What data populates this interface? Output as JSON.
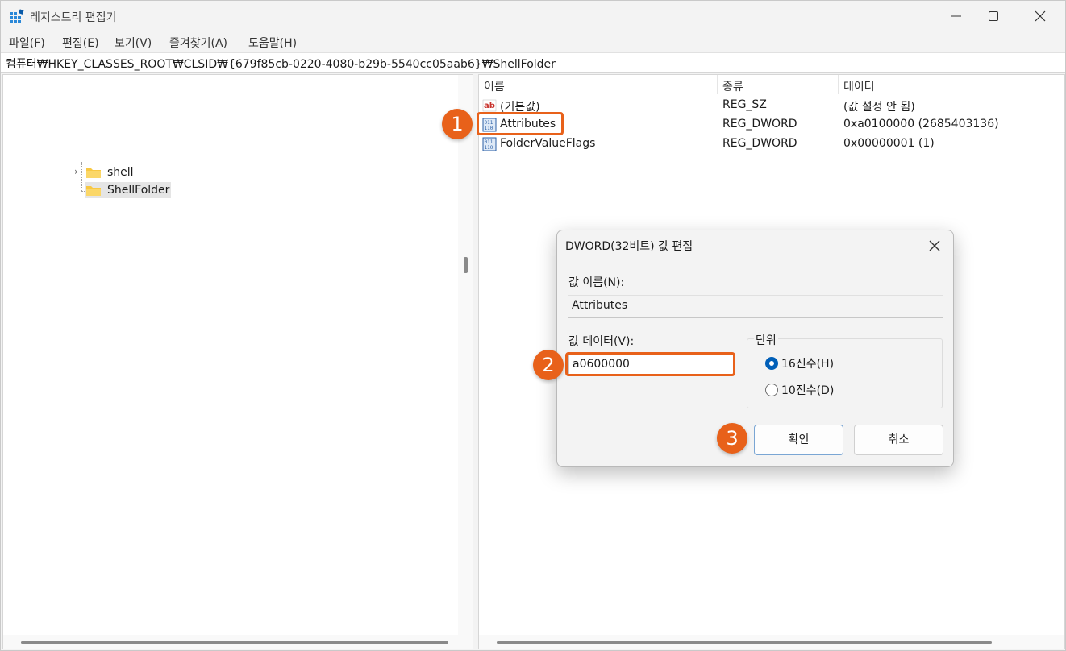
{
  "window": {
    "title": "레지스트리 편집기"
  },
  "menu": [
    "파일(F)",
    "편집(E)",
    "보기(V)",
    "즐겨찾기(A)",
    "도움말(H)"
  ],
  "address": "컴퓨터₩HKEY_CLASSES_ROOT₩CLSID₩{679f85cb-0220-4080-b29b-5540cc05aab6}₩ShellFolder",
  "tree": {
    "items": [
      {
        "label": "shell",
        "selected": false
      },
      {
        "label": "ShellFolder",
        "selected": true
      }
    ]
  },
  "values": {
    "columns": [
      "이름",
      "종류",
      "데이터"
    ],
    "rows": [
      {
        "icon": "string-value-icon",
        "name": "(기본값)",
        "type": "REG_SZ",
        "data": "(값 설정 안 됨)"
      },
      {
        "icon": "binary-value-icon",
        "name": "Attributes",
        "type": "REG_DWORD",
        "data": "0xa0100000 (2685403136)"
      },
      {
        "icon": "binary-value-icon",
        "name": "FolderValueFlags",
        "type": "REG_DWORD",
        "data": "0x00000001 (1)"
      }
    ]
  },
  "dialog": {
    "title": "DWORD(32비트) 값 편집",
    "name_label": "값 이름(N):",
    "name_value": "Attributes",
    "data_label": "값 데이터(V):",
    "data_value": "a0600000",
    "unit_label": "단위",
    "radio_hex": "16진수(H)",
    "radio_dec": "10진수(D)",
    "selected_unit": "hex",
    "ok": "확인",
    "cancel": "취소"
  },
  "steps": [
    "1",
    "2",
    "3"
  ],
  "colors": {
    "accent": "#e8611a",
    "selection_blue": "#005fb8",
    "folder": "#f8c842"
  }
}
